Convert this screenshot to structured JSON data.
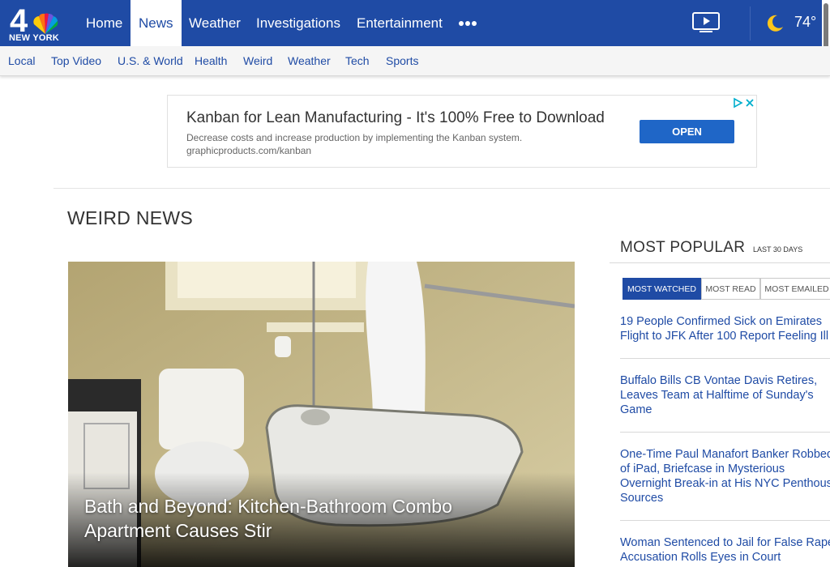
{
  "header": {
    "logo_number": "4",
    "logo_text": "NEW YORK",
    "nav": [
      "Home",
      "News",
      "Weather",
      "Investigations",
      "Entertainment"
    ],
    "more_icon": "more-dots-icon",
    "video_icon": "tv-play-icon",
    "weather_icon": "moon-icon",
    "temperature": "74°",
    "accent_color": "#1f4ba5"
  },
  "subnav": [
    "Local",
    "Top Video",
    "U.S. & World",
    "Health",
    "Weird",
    "Weather",
    "Tech",
    "Sports"
  ],
  "ad": {
    "title": "Kanban for Lean Manufacturing - It's 100% Free to Download",
    "description": "Decrease costs and increase production by implementing the Kanban system.",
    "url": "graphicproducts.com/kanban",
    "button": "OPEN"
  },
  "section_title": "WEIRD NEWS",
  "hero": {
    "caption": "Bath and Beyond: Kitchen-Bathroom Combo Apartment Causes Stir"
  },
  "most_popular": {
    "title": "MOST POPULAR",
    "subtitle": "LAST 30 DAYS",
    "tabs": [
      "MOST WATCHED",
      "MOST READ",
      "MOST EMAILED"
    ],
    "items": [
      [
        "19 People Confirmed Sick on Emirates",
        "Flight to JFK After 100 Report Feeling Ill"
      ],
      [
        "Buffalo Bills CB Vontae Davis Retires,",
        "Leaves Team at Halftime of Sunday's",
        "Game"
      ],
      [
        "One-Time Paul Manafort Banker Robbed",
        "of iPad, Briefcase in Mysterious",
        "Overnight Break-in at His NYC Penthouse:",
        "Sources"
      ],
      [
        "Woman Sentenced to Jail for False Rape",
        "Accusation Rolls Eyes in Court"
      ]
    ]
  }
}
